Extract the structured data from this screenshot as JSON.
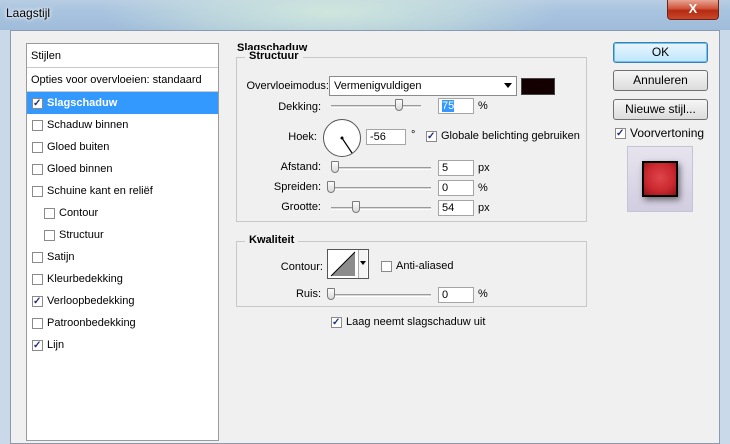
{
  "window": {
    "title": "Laagstijl",
    "close_glyph": "X"
  },
  "left_panel": {
    "header": "Stijlen",
    "blend_options": "Opties voor overvloeien: standaard",
    "items": [
      {
        "label": "Slagschaduw",
        "checked": true,
        "selected": true
      },
      {
        "label": "Schaduw binnen",
        "checked": false
      },
      {
        "label": "Gloed buiten",
        "checked": false
      },
      {
        "label": "Gloed binnen",
        "checked": false
      },
      {
        "label": "Schuine kant en reliëf",
        "checked": false
      },
      {
        "label": "Contour",
        "checked": false,
        "sub": true
      },
      {
        "label": "Structuur",
        "checked": false,
        "sub": true
      },
      {
        "label": "Satijn",
        "checked": false
      },
      {
        "label": "Kleurbedekking",
        "checked": false
      },
      {
        "label": "Verloopbedekking",
        "checked": true
      },
      {
        "label": "Patroonbedekking",
        "checked": false
      },
      {
        "label": "Lijn",
        "checked": true
      }
    ]
  },
  "main": {
    "section_title": "Slagschaduw",
    "structure": {
      "title": "Structuur",
      "blend_mode_label": "Overvloeimodus:",
      "blend_mode_value": "Vermenigvuldigen",
      "shadow_color": "#140000",
      "opacity_label": "Dekking:",
      "opacity_value": "75",
      "opacity_unit": "%",
      "opacity_fraction": 0.75,
      "angle_label": "Hoek:",
      "angle_value": "-56",
      "angle_unit": "°",
      "global_light_label": "Globale belichting gebruiken",
      "global_light_checked": true,
      "distance_label": "Afstand:",
      "distance_value": "5",
      "distance_unit": "px",
      "spread_label": "Spreiden:",
      "spread_value": "0",
      "spread_unit": "%",
      "size_label": "Grootte:",
      "size_value": "54",
      "size_unit": "px"
    },
    "quality": {
      "title": "Kwaliteit",
      "contour_label": "Contour:",
      "anti_aliased_label": "Anti-aliased",
      "anti_aliased_checked": false,
      "noise_label": "Ruis:",
      "noise_value": "0",
      "noise_unit": "%"
    },
    "knockout_label": "Laag neemt slagschaduw uit",
    "knockout_checked": true
  },
  "right_panel": {
    "ok_label": "OK",
    "cancel_label": "Annuleren",
    "new_style_label": "Nieuwe stijl...",
    "preview_label": "Voorvertoning",
    "preview_checked": true,
    "preview_color": "#c8272d"
  }
}
